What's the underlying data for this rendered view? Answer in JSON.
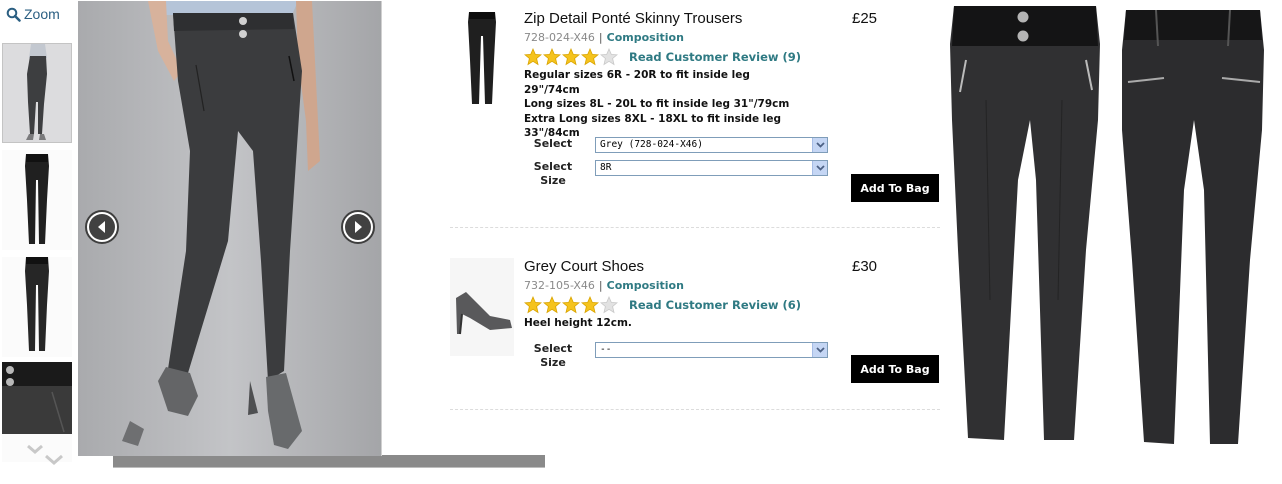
{
  "zoom": {
    "label": "Zoom",
    "icon": "magnifier-icon"
  },
  "gallery": {
    "thumbnails": [
      {
        "name": "thumb-model-front",
        "active": true
      },
      {
        "name": "thumb-trousers-front",
        "active": false
      },
      {
        "name": "thumb-trousers-back",
        "active": false
      },
      {
        "name": "thumb-waistband-detail",
        "active": false
      }
    ],
    "prev_icon": "chevron-left-icon",
    "next_icon": "chevron-right-icon",
    "scroll_down_icon": "chevron-down-icon"
  },
  "products": [
    {
      "name": "Zip Detail Ponté Skinny Trousers",
      "price": "£25",
      "code": "728-024-X46",
      "separator": "|",
      "composition_link": "Composition",
      "rating": 4,
      "rating_max": 5,
      "review_link": "Read Customer Review (9)",
      "description": [
        "Regular sizes 6R - 20R to fit inside leg 29\"/74cm",
        "Long sizes 8L - 20L to fit inside leg 31\"/79cm",
        "Extra Long sizes 8XL - 18XL to fit inside leg\n33\"/84cm"
      ],
      "select_colour_label": "Select",
      "select_colour_value": "Grey (728-024-X46)",
      "select_size_label": "Select\nSize",
      "select_size_value": "8R",
      "add_to_bag": "Add To Bag"
    },
    {
      "name": "Grey Court Shoes",
      "price": "£30",
      "code": "732-105-X46",
      "separator": "|",
      "composition_link": "Composition",
      "rating": 4,
      "rating_max": 5,
      "review_link": "Read Customer Review (6)",
      "description": [
        "Heel height 12cm."
      ],
      "select_size_label": "Select\nSize",
      "select_size_value": "--",
      "add_to_bag": "Add To Bag"
    }
  ],
  "colors": {
    "link": "#2f7a83",
    "star": "#f5c31d",
    "star_empty": "#e2e2e2",
    "button": "#000000",
    "select_border": "#7f9db9"
  }
}
